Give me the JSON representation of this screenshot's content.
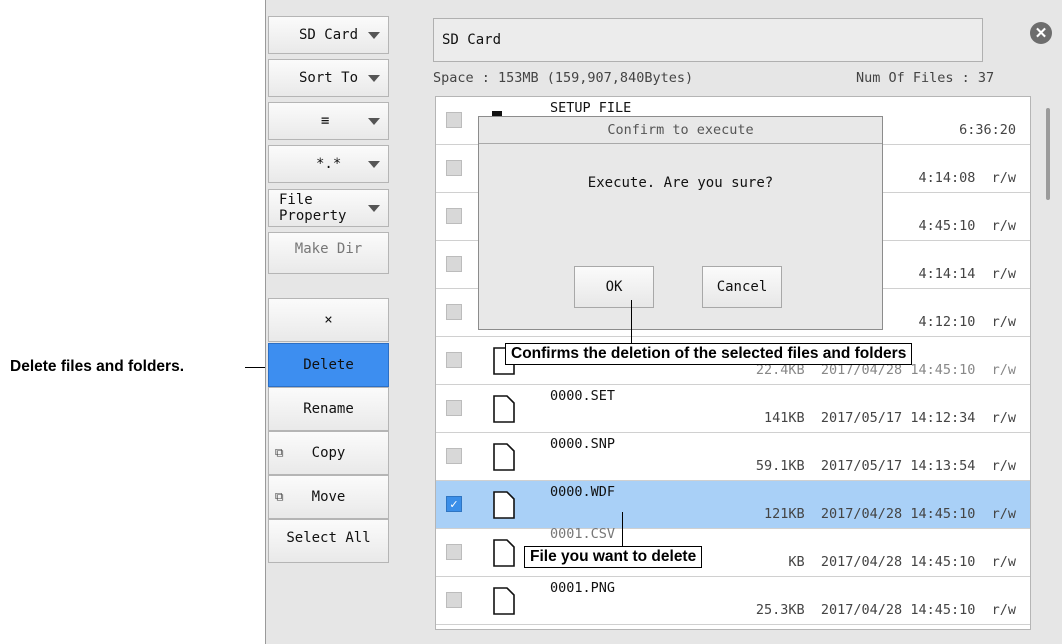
{
  "sidebar": {
    "dropdowns": [
      {
        "label": "SD Card"
      },
      {
        "label": "Sort To"
      },
      {
        "label": "≡"
      },
      {
        "label": "*.*"
      },
      {
        "label": "File Property"
      }
    ],
    "make_dir": "Make Dir",
    "actions": [
      {
        "label": "×"
      },
      {
        "label": "Delete"
      },
      {
        "label": "Rename"
      },
      {
        "label": "Copy"
      },
      {
        "label": "Move"
      },
      {
        "label": "Select All"
      }
    ]
  },
  "header": {
    "path": "SD Card",
    "space": "Space : 153MB (159,907,840Bytes)",
    "num_files": "Num Of Files : 37"
  },
  "files": [
    {
      "name": "SETUP FILE",
      "size": "",
      "date": "",
      "time": "6:36:20",
      "attr": "",
      "type": "folder",
      "selected": false
    },
    {
      "name": "",
      "size": "",
      "date": "",
      "time": "4:14:08",
      "attr": "r/w",
      "type": "file",
      "selected": false
    },
    {
      "name": "",
      "size": "",
      "date": "",
      "time": "4:45:10",
      "attr": "r/w",
      "type": "file",
      "selected": false
    },
    {
      "name": "",
      "size": "",
      "date": "",
      "time": "4:14:14",
      "attr": "r/w",
      "type": "file",
      "selected": false
    },
    {
      "name": "",
      "size": "",
      "date": "",
      "time": "4:12:10",
      "attr": "r/w",
      "type": "file",
      "selected": false
    },
    {
      "name": "",
      "size": "22.4KB",
      "date": "2017/04/28",
      "time": "14:45:10",
      "attr": "r/w",
      "type": "file",
      "selected": false
    },
    {
      "name": "0000.SET",
      "size": "141KB",
      "date": "2017/05/17",
      "time": "14:12:34",
      "attr": "r/w",
      "type": "file",
      "selected": false
    },
    {
      "name": "0000.SNP",
      "size": "59.1KB",
      "date": "2017/05/17",
      "time": "14:13:54",
      "attr": "r/w",
      "type": "file",
      "selected": false
    },
    {
      "name": "0000.WDF",
      "size": "121KB",
      "date": "2017/04/28",
      "time": "14:45:10",
      "attr": "r/w",
      "type": "file",
      "selected": true
    },
    {
      "name": "0001.CSV",
      "size": "KB",
      "date": "2017/04/28",
      "time": "14:45:10",
      "attr": "r/w",
      "type": "file",
      "selected": false
    },
    {
      "name": "0001.PNG",
      "size": "25.3KB",
      "date": "2017/04/28",
      "time": "14:45:10",
      "attr": "r/w",
      "type": "file",
      "selected": false
    }
  ],
  "dialog": {
    "title": "Confirm to execute",
    "message": "Execute. Are you sure?",
    "ok": "OK",
    "cancel": "Cancel"
  },
  "annotations": {
    "left": "Delete files and folders.",
    "dialog_note": "Confirms the deletion of the selected files and folders",
    "file_note": "File you want to delete"
  }
}
